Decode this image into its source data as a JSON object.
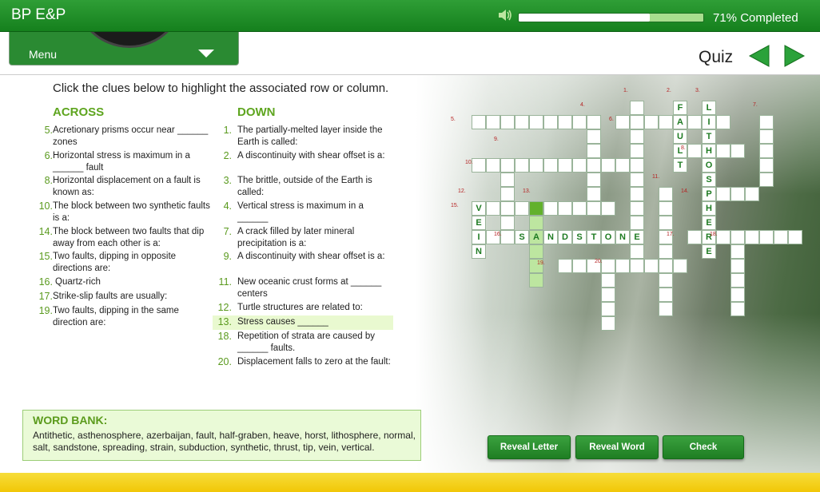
{
  "header": {
    "title": "BP E&P",
    "progress_percent": 71,
    "progress_label": "71% Completed",
    "icons": {
      "volume": "speaker-icon"
    }
  },
  "menu": {
    "label": "Menu",
    "icon": "chevron-down-icon"
  },
  "quiz": {
    "label": "Quiz",
    "prev_icon": "arrow-left-icon",
    "next_icon": "arrow-right-icon"
  },
  "instructions": "Click the clues below to highlight the associated row or column.",
  "across": {
    "heading": "ACROSS",
    "clues": [
      {
        "num": "5.",
        "text": "Acretionary prisms occur near ______ zones"
      },
      {
        "num": "6.",
        "text": "Horizontal stress is maximum in a ______ fault"
      },
      {
        "num": "8.",
        "text": "Horizontal displacement on a fault is known as:"
      },
      {
        "num": "10.",
        "text": "The block between two synthetic faults is a:"
      },
      {
        "num": "14.",
        "text": "The block between two faults that dip away from each other is a:"
      },
      {
        "num": "15.",
        "text": "Two faults, dipping in opposite directions are:"
      },
      {
        "num": "16.",
        "text": "Quartz-rich"
      },
      {
        "num": "17.",
        "text": "Strike-slip faults are usually:"
      },
      {
        "num": "19.",
        "text": "Two faults, dipping in the same direction are:"
      }
    ]
  },
  "down": {
    "heading": "DOWN",
    "clues": [
      {
        "num": "1.",
        "text": "The partially-melted layer  inside the Earth is called:"
      },
      {
        "num": "2.",
        "text": "A discontinuity with shear offset is a:"
      },
      {
        "num": "3.",
        "text": "The brittle, outside of the Earth is called:"
      },
      {
        "num": "4.",
        "text": "Vertical stress is maximum in a ______"
      },
      {
        "num": "7.",
        "text": "A crack filled by later mineral precipitation is a:"
      },
      {
        "num": "9.",
        "text": "A discontinuity with shear offset is a:"
      },
      {
        "num": "11.",
        "text": "New oceanic crust forms at ______ centers"
      },
      {
        "num": "12.",
        "text": "Turtle structures are related to:"
      },
      {
        "num": "13.",
        "text": "Stress causes ______",
        "active": true
      },
      {
        "num": "18.",
        "text": "Repetition of strata are caused by ______ faults."
      },
      {
        "num": "20.",
        "text": "Displacement falls to zero at the fault:"
      }
    ]
  },
  "word_bank": {
    "title": "WORD BANK:",
    "text": "Antithetic, asthenosphere, azerbaijan, fault, half-graben, heave, horst, lithosphere, normal, salt, sandstone, spreading, strain, subduction, synthetic, thrust, tip, vein, vertical."
  },
  "buttons": {
    "reveal_letter": "Reveal Letter",
    "reveal_word": "Reveal Word",
    "check": "Check"
  },
  "crossword": {
    "filled_letters": {
      "fault": [
        "F",
        "A",
        "U",
        "L",
        "T"
      ],
      "lithosphere": [
        "L",
        "I",
        "T",
        "H",
        "O",
        "S",
        "P",
        "H",
        "E",
        "R",
        "E"
      ],
      "vein": [
        "V",
        "E",
        "I",
        "N"
      ],
      "sandstone": [
        "S",
        "A",
        "N",
        "D",
        "S",
        "T",
        "O",
        "N",
        "E"
      ]
    },
    "numbers": [
      "1.",
      "2.",
      "3.",
      "4.",
      "5.",
      "6.",
      "7.",
      "8.",
      "9.",
      "10.",
      "11.",
      "12.",
      "13.",
      "14.",
      "15.",
      "16.",
      "17.",
      "18.",
      "19.",
      "20."
    ]
  },
  "colors": {
    "brand_green": "#1f8a26",
    "highlight": "#bde6a0",
    "footer": "#f4d21c",
    "accent_text": "#5ea51f"
  }
}
